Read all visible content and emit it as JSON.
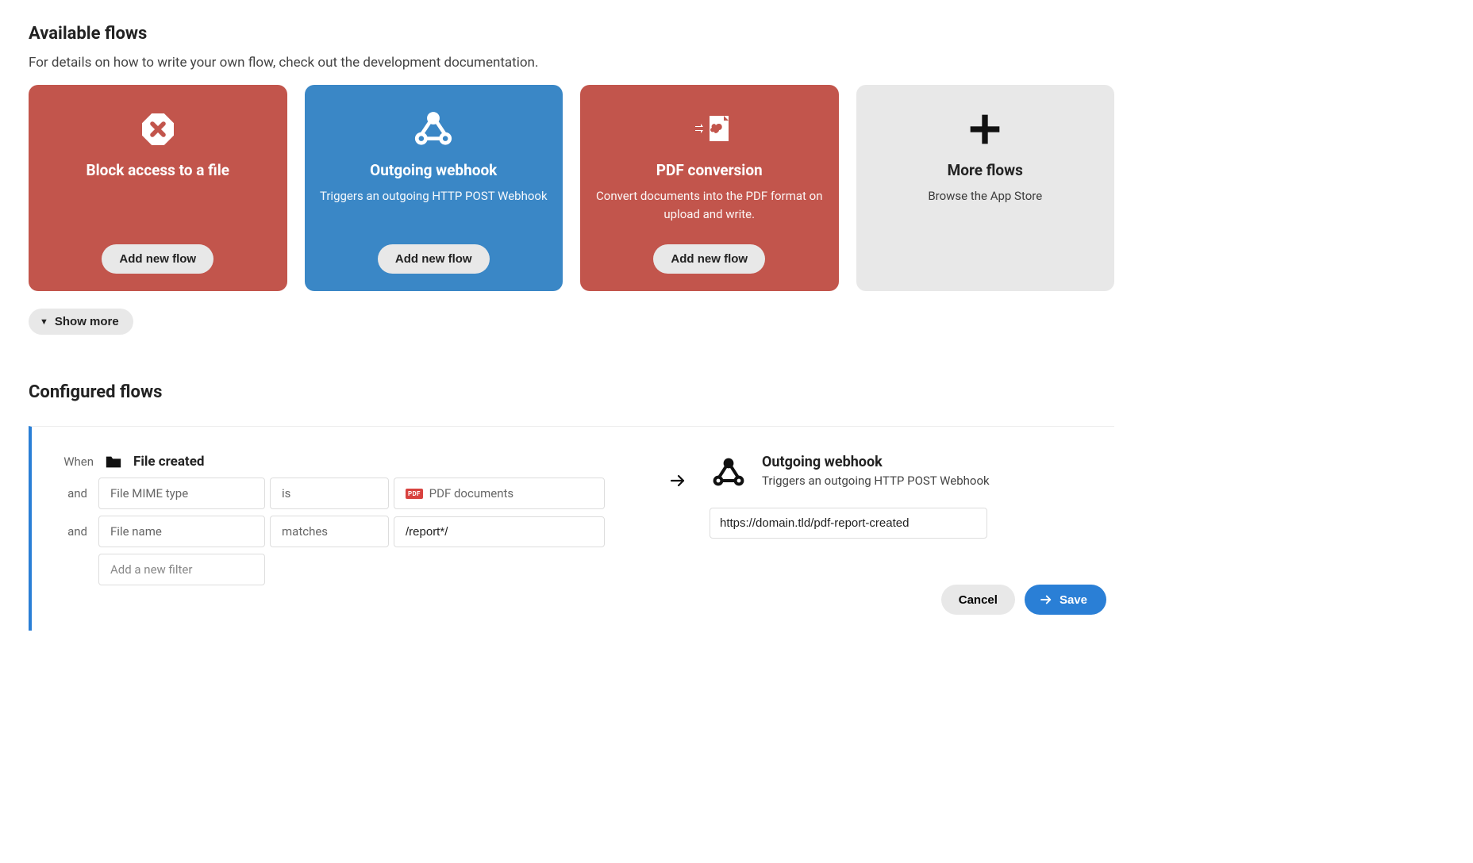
{
  "colors": {
    "red": "#c2554c",
    "blue": "#3a87c6",
    "gray": "#e8e8e8",
    "primary": "#2a7fd6"
  },
  "available": {
    "heading": "Available flows",
    "subtitle": "For details on how to write your own flow, check out the development documentation.",
    "add_label": "Add new flow",
    "show_more": "Show more",
    "cards": [
      {
        "title": "Block access to a file",
        "desc": ""
      },
      {
        "title": "Outgoing webhook",
        "desc": "Triggers an outgoing HTTP POST Webhook"
      },
      {
        "title": "PDF conversion",
        "desc": "Convert documents into the PDF format on upload and write."
      },
      {
        "title": "More flows",
        "desc": "Browse the App Store"
      }
    ]
  },
  "configured": {
    "heading": "Configured flows",
    "when_label": "When",
    "and_label": "and",
    "trigger_title": "File created",
    "filters": [
      {
        "field": "File MIME type",
        "op": "is",
        "value_label": "PDF documents",
        "value_badge": "PDF",
        "filled": false
      },
      {
        "field": "File name",
        "op": "matches",
        "value": "/report*/",
        "filled": true
      }
    ],
    "add_filter_placeholder": "Add a new filter",
    "action": {
      "title": "Outgoing webhook",
      "desc": "Triggers an outgoing HTTP POST Webhook",
      "url": "https://domain.tld/pdf-report-created"
    },
    "cancel": "Cancel",
    "save": "Save"
  }
}
